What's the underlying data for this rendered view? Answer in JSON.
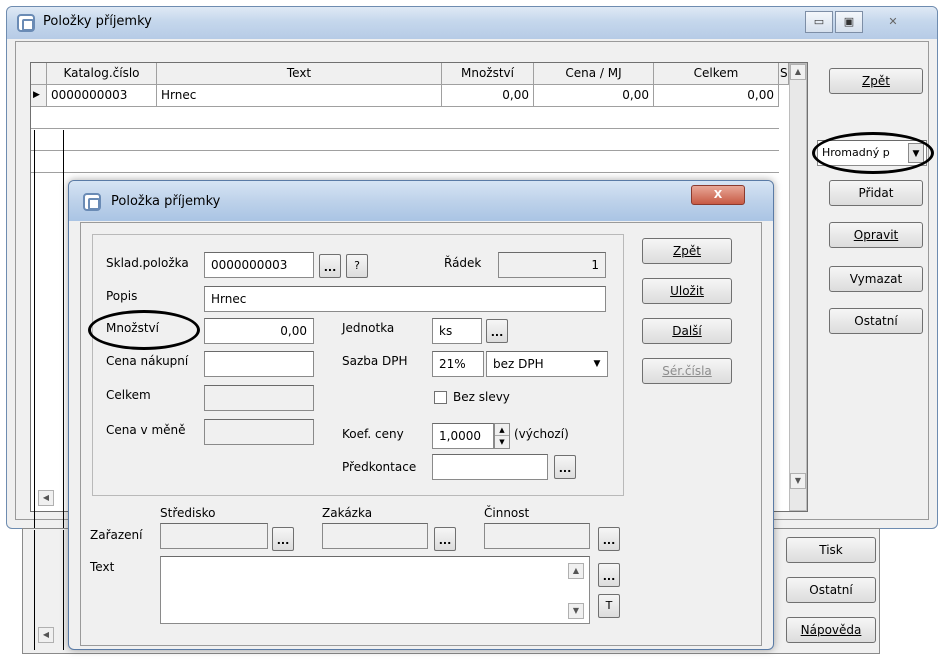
{
  "back_window": {
    "title": "Položky příjemky",
    "grid": {
      "columns": [
        "Katalog.číslo",
        "Text",
        "Množství",
        "Cena / MJ",
        "Celkem",
        "S"
      ],
      "rows": [
        [
          "0000000003",
          "Hrnec",
          "0,00",
          "0,00",
          "0,00"
        ]
      ]
    },
    "buttons": {
      "back": "Zpět",
      "combo": "Hromadný p",
      "add": "Přidat",
      "edit": "Opravit",
      "delete": "Vymazat",
      "other": "Ostatní",
      "print": "Tisk",
      "other2": "Ostatní",
      "help": "Nápověda"
    }
  },
  "dialog": {
    "title": "Položka příjemky",
    "close": "X",
    "fields": {
      "sklad_label": "Sklad.položka",
      "sklad_value": "0000000003",
      "radek_label": "Řádek",
      "radek_value": "1",
      "popis_label": "Popis",
      "popis_value": "Hrnec",
      "mnozstvi_label": "Množství",
      "mnozstvi_value": "0,00",
      "jednotka_label": "Jednotka",
      "jednotka_value": "ks",
      "cena_nakupni_label": "Cena nákupní",
      "cena_nakupni_value": "",
      "sazba_dph_label": "Sazba DPH",
      "sazba_value": "21%",
      "dph_mode": "bez DPH",
      "celkem_label": "Celkem",
      "bez_slevy_label": "Bez slevy",
      "cena_v_mene_label": "Cena v měně",
      "koef_label": "Koef. ceny",
      "koef_value": "1,0000",
      "vychozi": "(výchozí)",
      "predkontace_label": "Předkontace",
      "predkontace_value": "",
      "stredisko_label": "Středisko",
      "zakazka_label": "Zakázka",
      "cinnost_label": "Činnost",
      "zarazeni_label": "Zařazení",
      "text_label": "Text",
      "ellipsis": "...",
      "question": "?",
      "t_button": "T"
    },
    "buttons": {
      "back": "Zpět",
      "save": "Uložit",
      "next": "Další",
      "serial": "Sér.čísla"
    }
  },
  "win_controls": {
    "minimize": "▭",
    "maximize": "▣",
    "close": "✕"
  }
}
